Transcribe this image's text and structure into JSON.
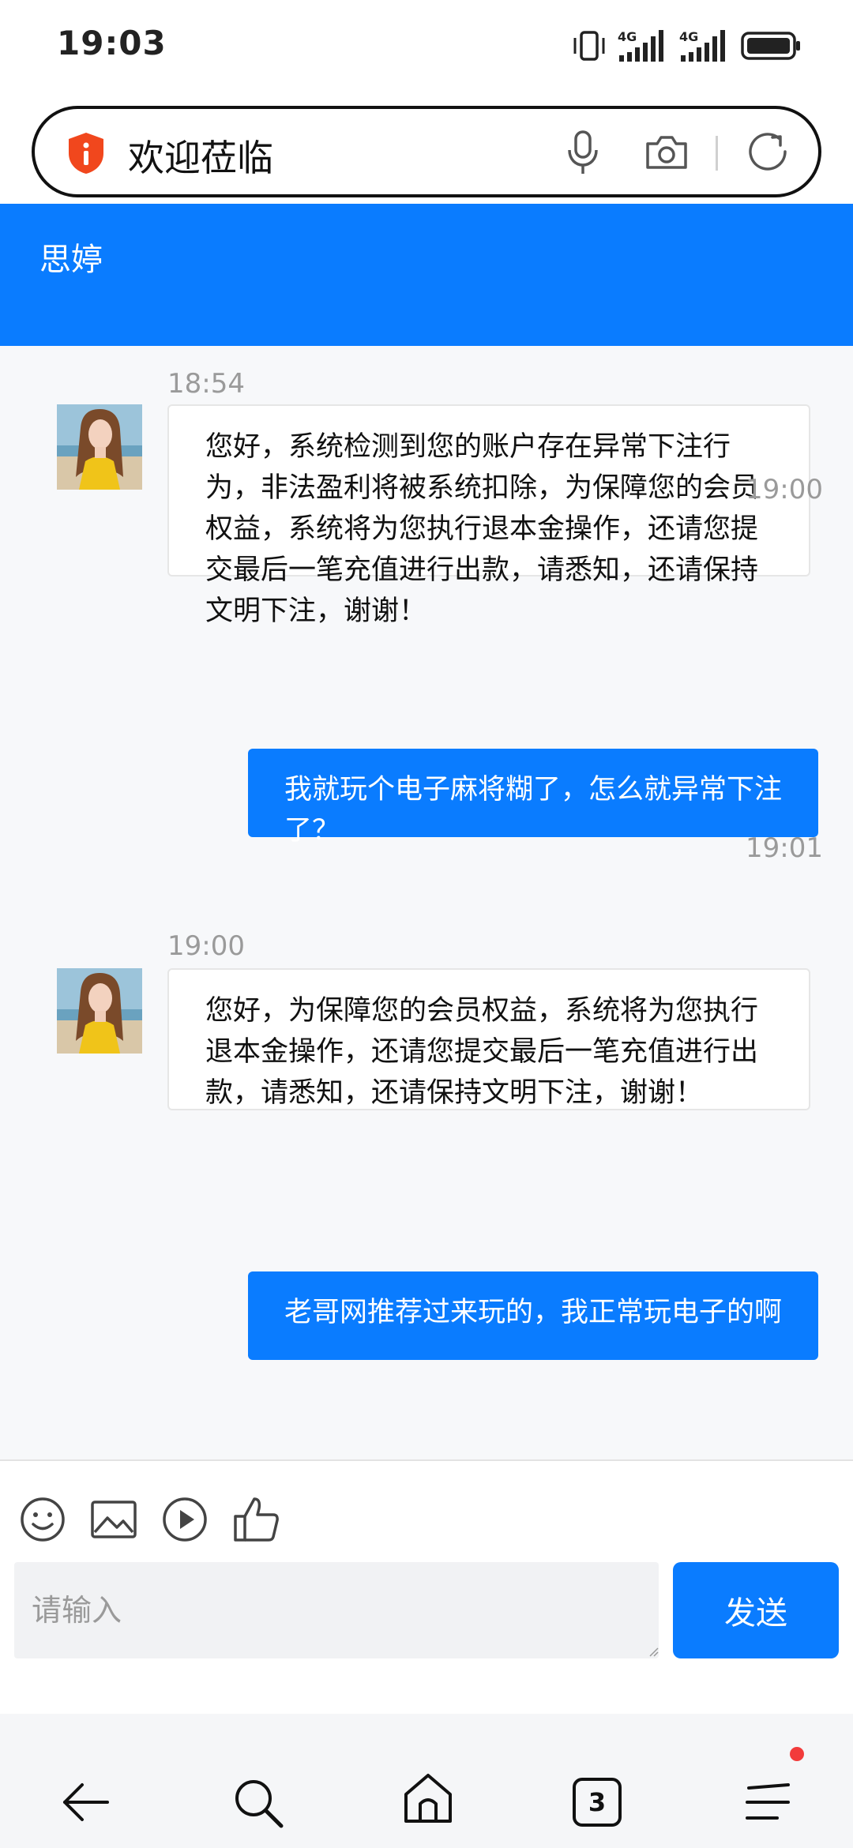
{
  "status_bar": {
    "time": "19:03",
    "network_1": "4G",
    "network_2": "4G"
  },
  "address_bar": {
    "title": "欢迎莅临"
  },
  "chat": {
    "contact_name": "思婷",
    "messages": [
      {
        "direction": "in",
        "time": "18:54",
        "text": "您好，系统检测到您的账户存在异常下注行为，非法盈利将被系统扣除，为保障您的会员权益，系统将为您执行退本金操作，还请您提交最后一笔充值进行出款，请悉知，还请保持文明下注，谢谢！"
      },
      {
        "direction": "out",
        "time": "19:00",
        "text": "我就玩个电子麻将糊了，怎么就异常下注了？"
      },
      {
        "direction": "in",
        "time": "19:00",
        "text": "您好，为保障您的会员权益，系统将为您执行退本金操作，还请您提交最后一笔充值进行出款，请悉知，还请保持文明下注，谢谢！"
      },
      {
        "direction": "out",
        "time": "19:01",
        "text": "老哥网推荐过来玩的，我正常玩电子的啊"
      }
    ]
  },
  "composer": {
    "tools": [
      "emoji-icon",
      "image-icon",
      "video-icon",
      "thumbs-up-icon"
    ],
    "input_placeholder": "请输入",
    "input_value": "",
    "send_label": "发送"
  },
  "bottom_nav": {
    "tab_count": "3",
    "items": [
      "back-arrow-icon",
      "search-icon",
      "home-icon",
      "tabs-icon",
      "menu-icon"
    ]
  },
  "colors": {
    "accent": "#0a7cff",
    "notification": "#f23b3b"
  }
}
